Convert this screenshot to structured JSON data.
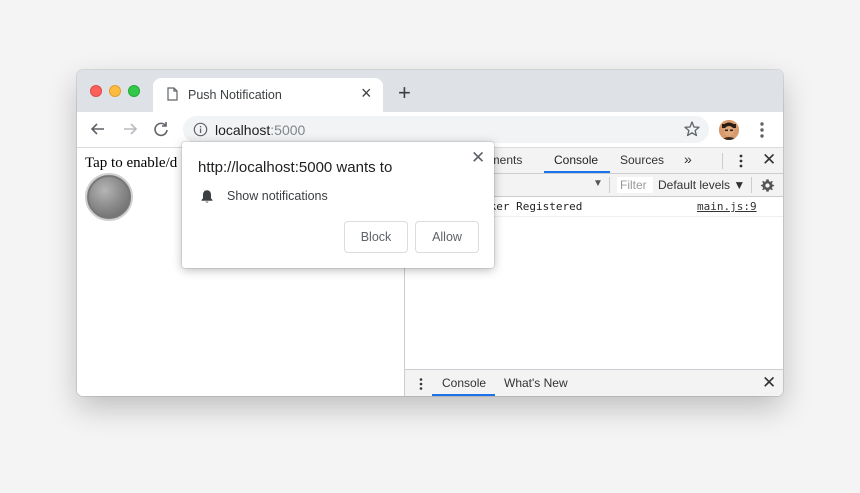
{
  "browser": {
    "tab": {
      "title": "Push Notification"
    },
    "toolbar": {
      "url_host": "localhost",
      "url_port": ":5000"
    }
  },
  "page": {
    "tap_text": "Tap to enable/d"
  },
  "devtools": {
    "tabs": [
      "ements",
      "Console",
      "Sources",
      "»"
    ],
    "active_tab": "Console",
    "filter_placeholder": "Filter",
    "levels_label": "Default levels ▼",
    "log": [
      {
        "message": "rker Registered",
        "source": "main.js:9"
      }
    ],
    "drawer": {
      "tabs": [
        "Console",
        "What's New"
      ],
      "active_tab": "Console"
    }
  },
  "permission_popup": {
    "title": "http://localhost:5000 wants to",
    "permission": "Show notifications",
    "block_label": "Block",
    "allow_label": "Allow"
  },
  "colors": {
    "accent": "#1a73e8",
    "tabstrip": "#dee1e6",
    "omnibox": "#f1f3f4"
  }
}
